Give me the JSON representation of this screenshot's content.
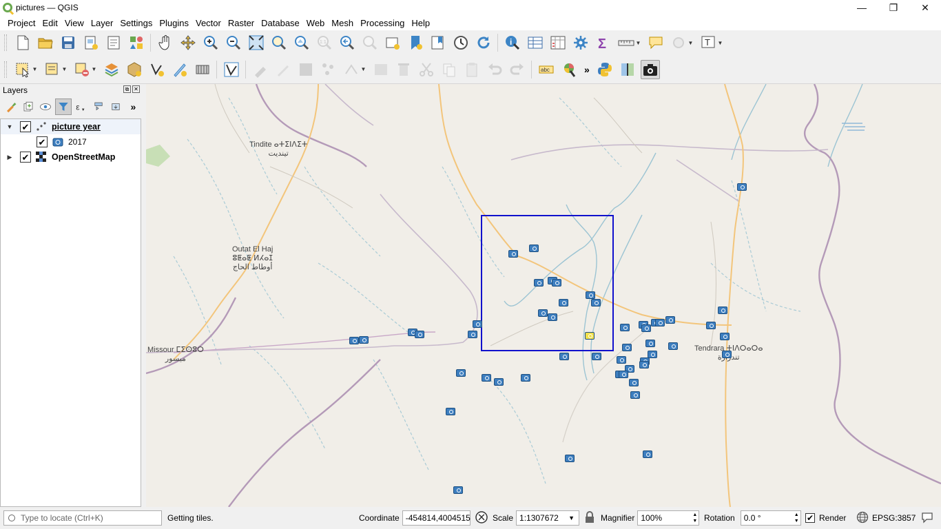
{
  "window": {
    "title": "pictures — QGIS",
    "minimize": "—",
    "maximize": "❐",
    "close": "✕"
  },
  "menu": [
    "Project",
    "Edit",
    "View",
    "Layer",
    "Settings",
    "Plugins",
    "Vector",
    "Raster",
    "Database",
    "Web",
    "Mesh",
    "Processing",
    "Help"
  ],
  "layers_panel": {
    "title": "Layers",
    "layers": [
      {
        "name": "picture year",
        "checked": true,
        "expanded": true,
        "symbol_label": "2017"
      },
      {
        "name": "OpenStreetMap",
        "checked": true,
        "expanded": false
      }
    ]
  },
  "map": {
    "places": [
      {
        "name": "Tindite ⴰⵜⵉⵏⴷⵉⵜ",
        "arabic": "تيندیت"
      },
      {
        "name": "Outat El Haj",
        "tifinagh": "ⵓⵟⴰⵟ ⵍⵃⴰⵊ",
        "arabic": "أوطاط الحاج"
      },
      {
        "name": "Missour ⵎⵉⵙⵓⵔ",
        "arabic": "ميسور"
      },
      {
        "name": "Tendrara ⵜⵏⴷⵔⴰⵔⴰ",
        "arabic": "تندرارة"
      }
    ],
    "marker_color": "#3d7ebf",
    "selection_color": "#1010cc"
  },
  "status": {
    "locate_placeholder": "Type to locate (Ctrl+K)",
    "message": "Getting tiles.",
    "coordinate_label": "Coordinate",
    "coordinate_value": "-454814,4004515",
    "scale_label": "Scale",
    "scale_value": "1:1307672",
    "magnifier_label": "Magnifier",
    "magnifier_value": "100%",
    "rotation_label": "Rotation",
    "rotation_value": "0.0 °",
    "render_label": "Render",
    "crs": "EPSG:3857"
  }
}
